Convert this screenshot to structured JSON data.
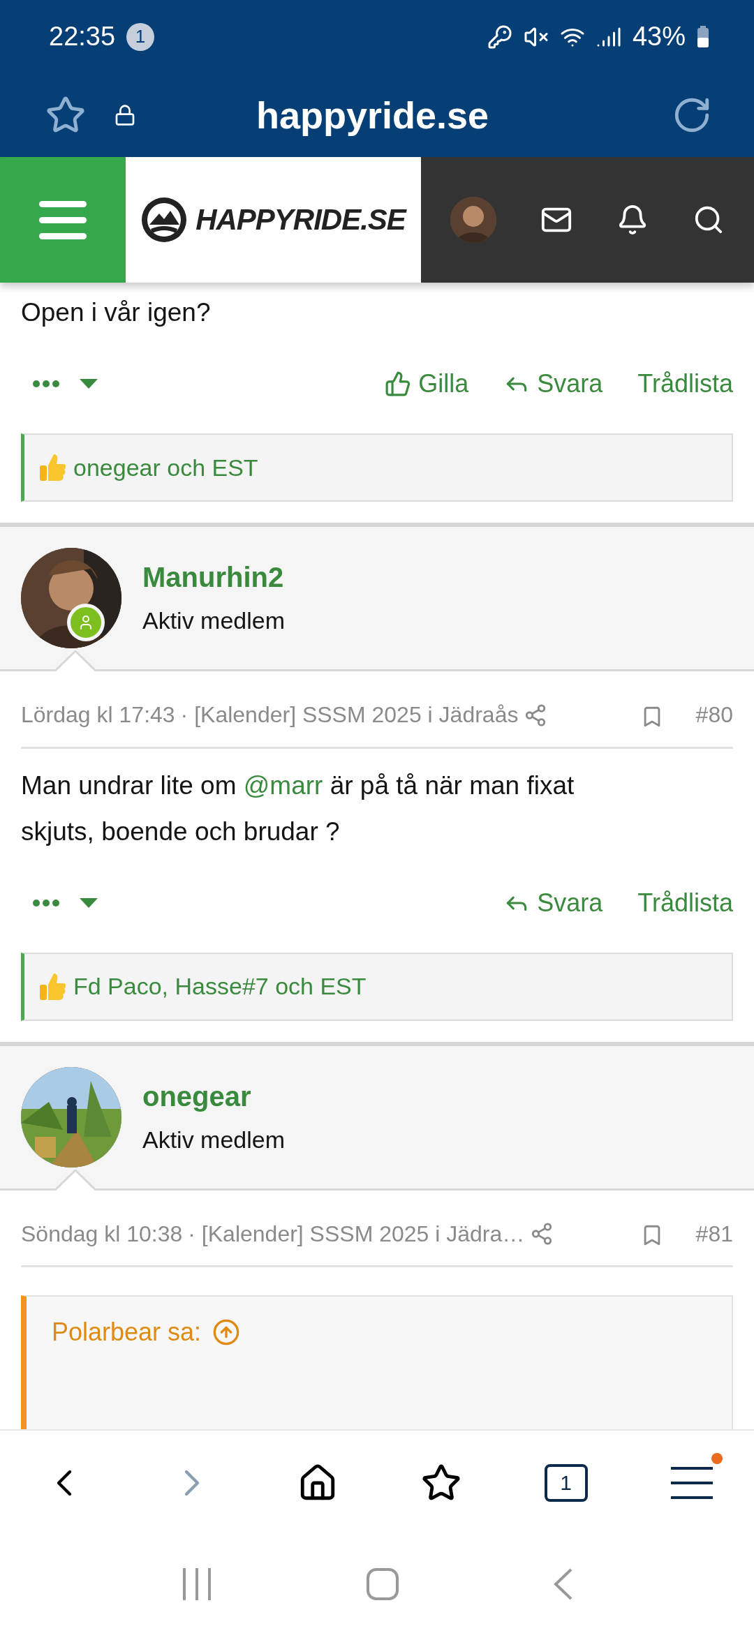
{
  "status_bar": {
    "time": "22:35",
    "notification_count": "1",
    "battery": "43%"
  },
  "url_bar": {
    "domain": "happyride.se"
  },
  "site_header": {
    "logo_text": "HAPPYRIDE.SE"
  },
  "posts": [
    {
      "tail_text": "Open i vår igen?",
      "actions": [
        {
          "kind": "like",
          "label": "Gilla"
        },
        {
          "kind": "reply",
          "label": "Svara"
        },
        {
          "kind": "thread",
          "label": "Trådlista"
        }
      ],
      "reactions": "onegear och EST"
    },
    {
      "author": "Manurhin2",
      "role": "Aktiv medlem",
      "online": true,
      "date": "Lördag kl 17:43",
      "thread": "· [Kalender] SSSM 2025 i Jädraås",
      "number": "#80",
      "body": [
        {
          "kind": "text",
          "text": "Man undrar lite om "
        },
        {
          "kind": "mention",
          "text": "@marr"
        },
        {
          "kind": "text",
          "text": " är på tå när man fixat skjuts, boende och brudar ?"
        }
      ],
      "actions": [
        {
          "kind": "reply",
          "label": "Svara"
        },
        {
          "kind": "thread",
          "label": "Trådlista"
        }
      ],
      "reactions": "Fd Paco, Hasse#7 och EST"
    },
    {
      "author": "onegear",
      "role": "Aktiv medlem",
      "online": false,
      "date": "Söndag kl 10:38",
      "thread": "· [Kalender] SSSM 2025 i Jädra…",
      "number": "#81",
      "quote": {
        "author": "Polarbear sa:"
      }
    }
  ],
  "browser_toolbar": {
    "tab_count": "1",
    "menu_badge": true
  }
}
